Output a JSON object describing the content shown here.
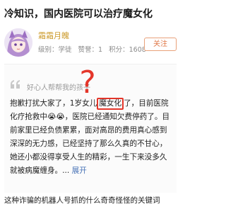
{
  "article": {
    "title": "冷知识，国内医院可以治疗魔女化"
  },
  "author": {
    "name": "霜霜月魄",
    "grade": "级别：学徒",
    "likes": "赞誉：1",
    "points": "积分：1608",
    "follow_label": "关注"
  },
  "post_image": {
    "poster": "好心人帮帮我的孩子",
    "question_mark": "?",
    "text_before": "抱歉打扰大家了，1岁女儿",
    "highlight": "魔女化",
    "text_after": "了，目前医院化疗抢救中😭😭，医院已经通知欠费停药了。目前家里已经负债累累，面对高昂的费用真心感到深深的无力感，已经坚持了那么久真的不甘心，她还小都没得享受人生的精彩，一生下来没多久就被病魔缠身。",
    "expand_label": "展开"
  },
  "footer": {
    "text": "这种诈骗的机器人号抓的什么奇奇怪怪的关键词"
  },
  "colors": {
    "author_name": "#cc9a2a",
    "follow": "#e07848",
    "highlight_box": "#e4362a",
    "expand": "#4a74b7",
    "question_mark": "#e4362a"
  }
}
